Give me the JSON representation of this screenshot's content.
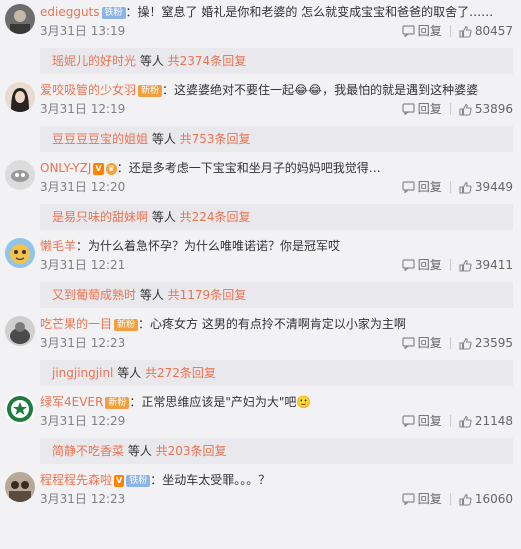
{
  "comments": [
    {
      "username": "ediegguts",
      "badge": "铁粉",
      "badge_type": "fan",
      "text": "：操！窒息了 婚礼是你和老婆的 怎么就变成宝宝和爸爸的取舍了……",
      "time": "3月31日 13:19",
      "reply_label": "回复",
      "like_count": "80457",
      "replies": {
        "replier": "瑶妮儿的好时光",
        "middle": " 等人 ",
        "tail": "共2374条回复"
      }
    },
    {
      "username": "爱咬吸管的少女羽",
      "badge": "新粉",
      "badge_type": "vip",
      "text": "：这婆婆绝对不要住一起😂😂，我最怕的就是遇到这种婆婆",
      "time": "3月31日 12:19",
      "reply_label": "回复",
      "like_count": "53896",
      "replies": {
        "replier": "豆豆豆豆宝的姐姐",
        "middle": " 等人 ",
        "tail": "共753条回复"
      }
    },
    {
      "username": "ONLY-YZJ",
      "badge": "V",
      "badge_type": "v",
      "text": "：还是多考虑一下宝宝和坐月子的妈妈吧我觉得…",
      "time": "3月31日 12:20",
      "reply_label": "回复",
      "like_count": "39449",
      "replies": {
        "replier": "是易只味的甜妹啊",
        "middle": " 等人 ",
        "tail": "共224条回复"
      }
    },
    {
      "username": "懒毛羊",
      "badge": "",
      "badge_type": "",
      "text": "：为什么着急怀孕？为什么唯唯诺诺？你是冠军哎",
      "time": "3月31日 12:21",
      "reply_label": "回复",
      "like_count": "39411",
      "replies": {
        "replier": "又到葡萄成熟时",
        "middle": " 等人 ",
        "tail": "共1179条回复"
      }
    },
    {
      "username": "吃芒果的一目",
      "badge": "新粉",
      "badge_type": "vip",
      "text": "：心疼女方 这男的有点拎不清啊肯定以小家为主啊",
      "time": "3月31日 12:23",
      "reply_label": "回复",
      "like_count": "23595",
      "replies": {
        "replier": "jingjingjinl",
        "middle": " 等人 ",
        "tail": "共272条回复"
      }
    },
    {
      "username": "绿军4EVER",
      "badge": "新粉",
      "badge_type": "vip",
      "text": "：正常思维应该是\"产妇为大\"吧🙂",
      "time": "3月31日 12:29",
      "reply_label": "回复",
      "like_count": "21148",
      "replies": {
        "replier": "简静不吃香菜",
        "middle": " 等人 ",
        "tail": "共203条回复"
      }
    },
    {
      "username": "程程程先森啦",
      "badge": "铁粉",
      "badge_type": "fan",
      "text": "：坐动车太受罪。。。？",
      "time": "3月31日 12:23",
      "reply_label": "回复",
      "like_count": "16060",
      "replies": null
    }
  ],
  "colors": {
    "username": "#eb7350",
    "bg": "#f2f2f5",
    "reply_bg": "#e8e8ed"
  }
}
